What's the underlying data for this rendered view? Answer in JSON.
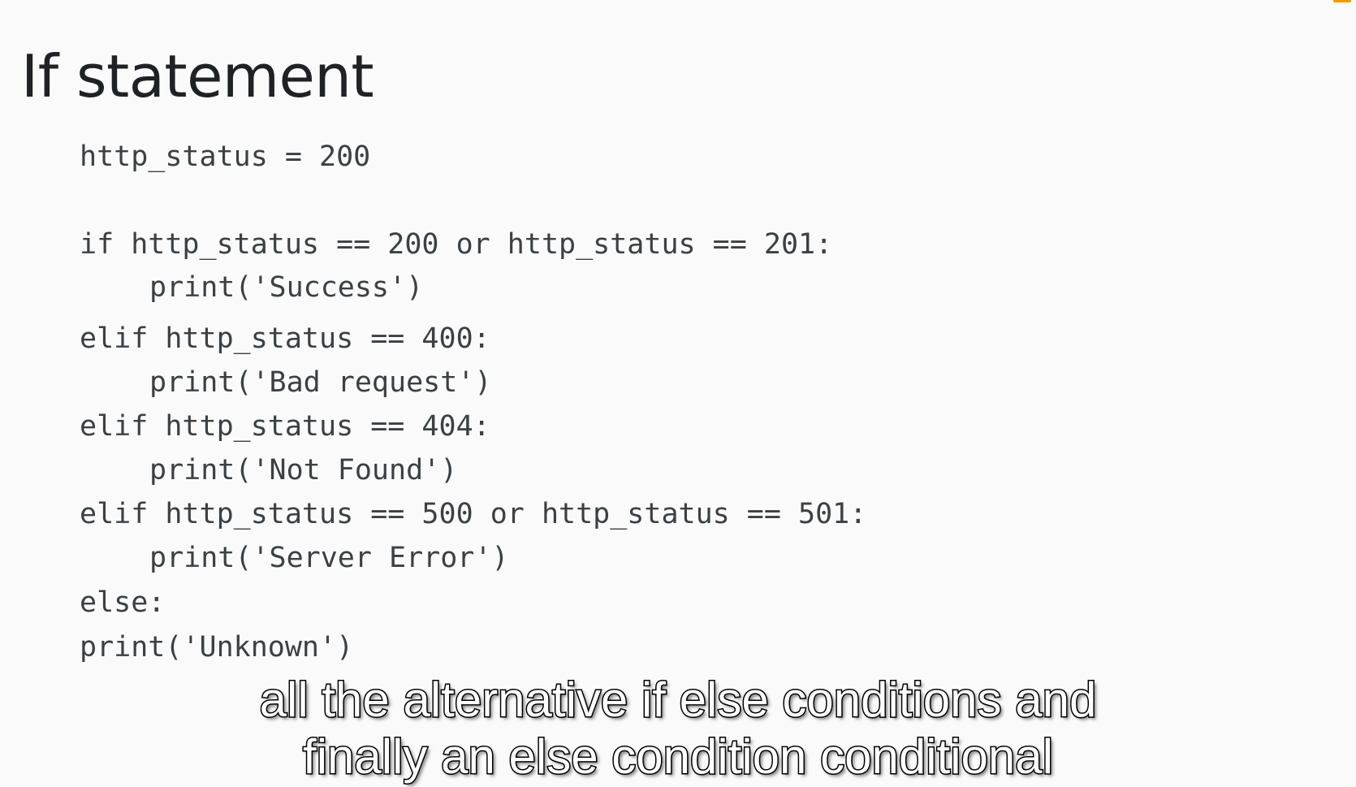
{
  "slide": {
    "title": "If statement",
    "code_lines": [
      "http_status = 200",
      "if http_status == 200 or http_status == 201:",
      "print('Success')",
      "elif http_status == 400:",
      "print('Bad request')",
      "elif http_status == 404:",
      "print('Not Found')",
      "elif http_status == 500 or http_status == 501:",
      "print('Server Error')",
      "else:",
      "print('Unknown')"
    ]
  },
  "subtitles": {
    "line1": "all the alternative if else conditions and",
    "line2": "finally an else condition conditional"
  },
  "colors": {
    "background": "#fafafa",
    "title": "#202124",
    "code": "#3c4043",
    "caption_fill": "#ffffff",
    "caption_outline": "#000000"
  }
}
